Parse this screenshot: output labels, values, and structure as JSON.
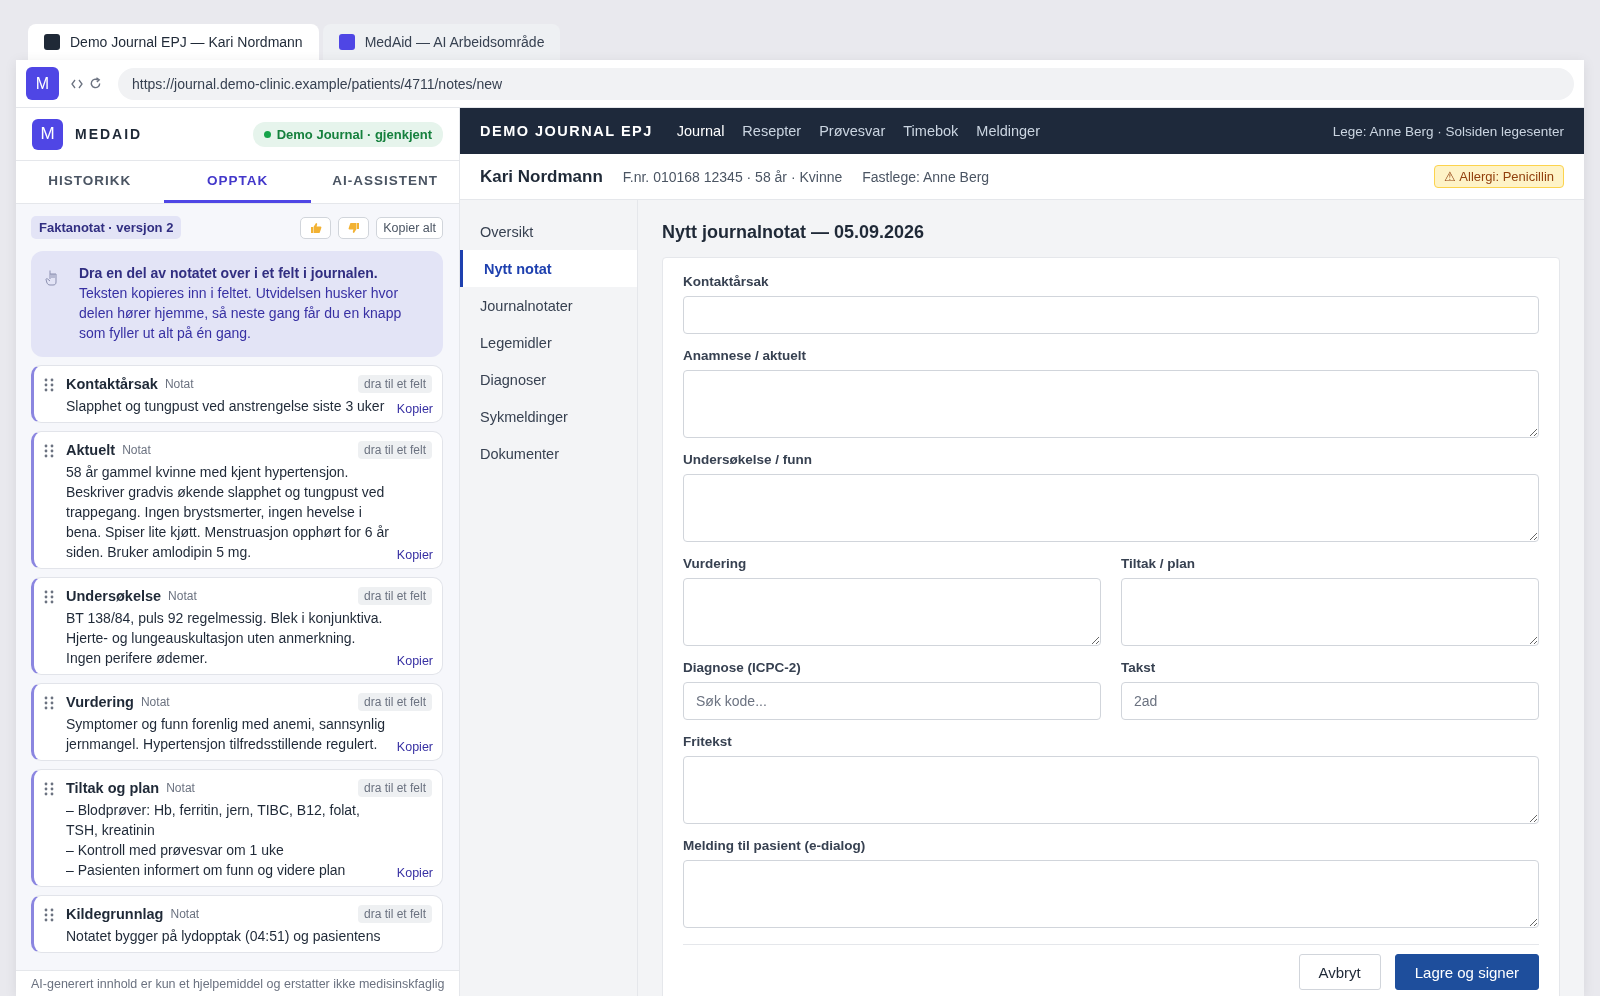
{
  "browser": {
    "tabs": [
      {
        "title": "Demo Journal EPJ — Kari Nordmann",
        "color": "#1f2937",
        "selected": true
      },
      {
        "title": "MedAid — AI Arbeidsområde",
        "color": "#4f46e5",
        "selected": false
      }
    ],
    "extension_letter": "M",
    "url": "https://journal.demo-clinic.example/patients/4711/notes/new"
  },
  "extension": {
    "logo_letter": "M",
    "name": "MEDAID",
    "status": "Demo Journal · gjenkjent",
    "tabs": [
      {
        "label": "HISTORIKK",
        "selected": false
      },
      {
        "label": "OPPTAK",
        "selected": true
      },
      {
        "label": "AI-ASSISTENT",
        "selected": false
      }
    ],
    "version_badge": "Faktanotat · versjon 2",
    "copy_all": "Kopier alt",
    "hint": {
      "title": "Dra en del av notatet over i et felt i journalen.",
      "body": "Teksten kopieres inn i feltet. Utvidelsen husker hvor delen hører hjemme, så neste gang får du en knapp som fyller ut alt på én gang."
    },
    "sections": [
      {
        "title": "Kontaktårsak",
        "tag": "Notat",
        "drag_label": "dra til et felt",
        "lines": [
          "Slapphet og tungpust ved anstrengelse siste 3 uker"
        ],
        "copy": "Kopier"
      },
      {
        "title": "Aktuelt",
        "tag": "Notat",
        "drag_label": "dra til et felt",
        "lines": [
          "58 år gammel kvinne med kjent hypertensjon. Beskriver gradvis økende slapphet og tungpust ved trappegang. Ingen brystsmerter, ingen hevelse i bena. Spiser lite kjøtt. Menstruasjon opphørt for 6 år siden. Bruker amlodipin 5 mg."
        ],
        "copy": "Kopier"
      },
      {
        "title": "Undersøkelse",
        "tag": "Notat",
        "drag_label": "dra til et felt",
        "lines": [
          "BT 138/84, puls 92 regelmessig. Blek i konjunktiva. Hjerte- og lungeauskultasjon uten anmerkning. Ingen perifere ødemer."
        ],
        "copy": "Kopier"
      },
      {
        "title": "Vurdering",
        "tag": "Notat",
        "drag_label": "dra til et felt",
        "lines": [
          "Symptomer og funn forenlig med anemi, sannsynlig jernmangel. Hypertensjon tilfredsstillende regulert."
        ],
        "copy": "Kopier"
      },
      {
        "title": "Tiltak og plan",
        "tag": "Notat",
        "drag_label": "dra til et felt",
        "lines": [
          "– Blodprøver: Hb, ferritin, jern, TIBC, B12, folat, TSH, kreatinin",
          "– Kontroll med prøvesvar om 1 uke",
          "– Pasienten informert om funn og videre plan"
        ],
        "copy": "Kopier"
      },
      {
        "title": "Kildegrunnlag",
        "tag": "Notat",
        "drag_label": "dra til et felt",
        "lines": [
          "Notatet bygger på lydopptak (04:51) og pasientens"
        ]
      }
    ],
    "footer": "AI-generert innhold er kun et hjelpemiddel og erstatter ikke medisinskfaglig"
  },
  "epj": {
    "brand": "DEMO JOURNAL EPJ",
    "nav": [
      {
        "label": "Journal",
        "selected": true
      },
      {
        "label": "Resepter",
        "selected": false
      },
      {
        "label": "Prøvesvar",
        "selected": false
      },
      {
        "label": "Timebok",
        "selected": false
      },
      {
        "label": "Meldinger",
        "selected": false
      }
    ],
    "user": "Lege: Anne Berg · Solsiden legesenter",
    "patient": {
      "name": "Kari Nordmann",
      "info": "F.nr. 010168 12345 · 58 år · Kvinne",
      "gp": "Fastlege: Anne Berg",
      "allergy": "⚠ Allergi: Penicillin"
    },
    "sidebar": [
      {
        "label": "Oversikt",
        "selected": false
      },
      {
        "label": "Nytt notat",
        "selected": true
      },
      {
        "label": "Journalnotater",
        "selected": false
      },
      {
        "label": "Legemidler",
        "selected": false
      },
      {
        "label": "Diagnoser",
        "selected": false
      },
      {
        "label": "Sykmeldinger",
        "selected": false
      },
      {
        "label": "Dokumenter",
        "selected": false
      }
    ],
    "form": {
      "title": "Nytt journalnotat — 05.09.2026",
      "rows": [
        [
          {
            "label": "Kontaktårsak",
            "kind": "input"
          }
        ],
        [
          {
            "label": "Anamnese / aktuelt",
            "kind": "textarea"
          }
        ],
        [
          {
            "label": "Undersøkelse / funn",
            "kind": "textarea"
          }
        ],
        [
          {
            "label": "Vurdering",
            "kind": "textarea"
          },
          {
            "label": "Tiltak / plan",
            "kind": "textarea"
          }
        ],
        [
          {
            "label": "Diagnose (ICPC-2)",
            "kind": "input",
            "placeholder": "Søk kode..."
          },
          {
            "label": "Takst",
            "kind": "input",
            "placeholder": "2ad"
          }
        ],
        [
          {
            "label": "Fritekst",
            "kind": "textarea"
          }
        ],
        [
          {
            "label": "Melding til pasient (e-dialog)",
            "kind": "textarea"
          }
        ]
      ],
      "buttons": [
        {
          "label": "Avbryt",
          "kind": "secondary"
        },
        {
          "label": "Lagre og signer",
          "kind": "primary"
        }
      ]
    }
  }
}
